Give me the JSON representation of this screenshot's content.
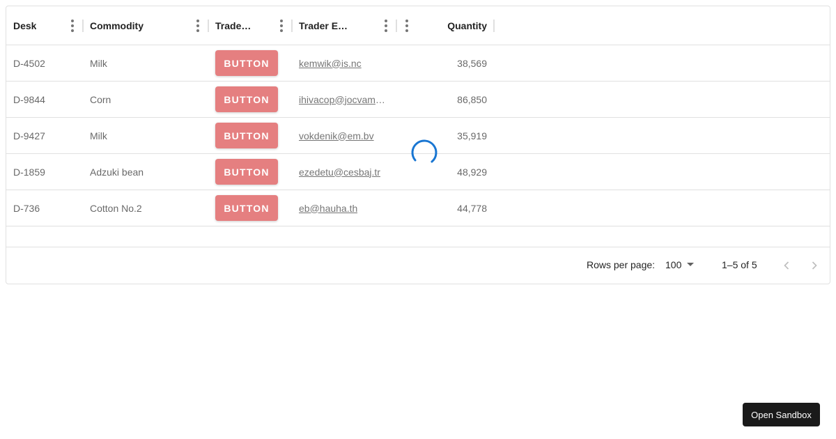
{
  "columns": [
    {
      "key": "desk",
      "label": "Desk"
    },
    {
      "key": "commodity",
      "label": "Commodity"
    },
    {
      "key": "trader_name",
      "label": "Trader Name"
    },
    {
      "key": "trader_email",
      "label": "Trader Email"
    },
    {
      "key": "quantity",
      "label": "Quantity"
    }
  ],
  "rows": [
    {
      "desk": "D-4502",
      "commodity": "Milk",
      "button": "BUTTON",
      "email": "kemwik@is.nc",
      "quantity": "38,569"
    },
    {
      "desk": "D-9844",
      "commodity": "Corn",
      "button": "BUTTON",
      "email": "ihivacop@jocvamu…",
      "quantity": "86,850"
    },
    {
      "desk": "D-9427",
      "commodity": "Milk",
      "button": "BUTTON",
      "email": "vokdenik@em.bv",
      "quantity": "35,919"
    },
    {
      "desk": "D-1859",
      "commodity": "Adzuki bean",
      "button": "BUTTON",
      "email": "ezedetu@cesbaj.tr",
      "quantity": "48,929"
    },
    {
      "desk": "D-736",
      "commodity": "Cotton No.2",
      "button": "BUTTON",
      "email": "eb@hauha.th",
      "quantity": "44,778"
    }
  ],
  "footer": {
    "rows_per_page_label": "Rows per page:",
    "rows_per_page_value": "100",
    "range": "1–5 of 5"
  },
  "sandbox_label": "Open Sandbox",
  "colors": {
    "button_bg": "#e57f80",
    "spinner": "#1976d2",
    "border": "#e0e0e0"
  }
}
